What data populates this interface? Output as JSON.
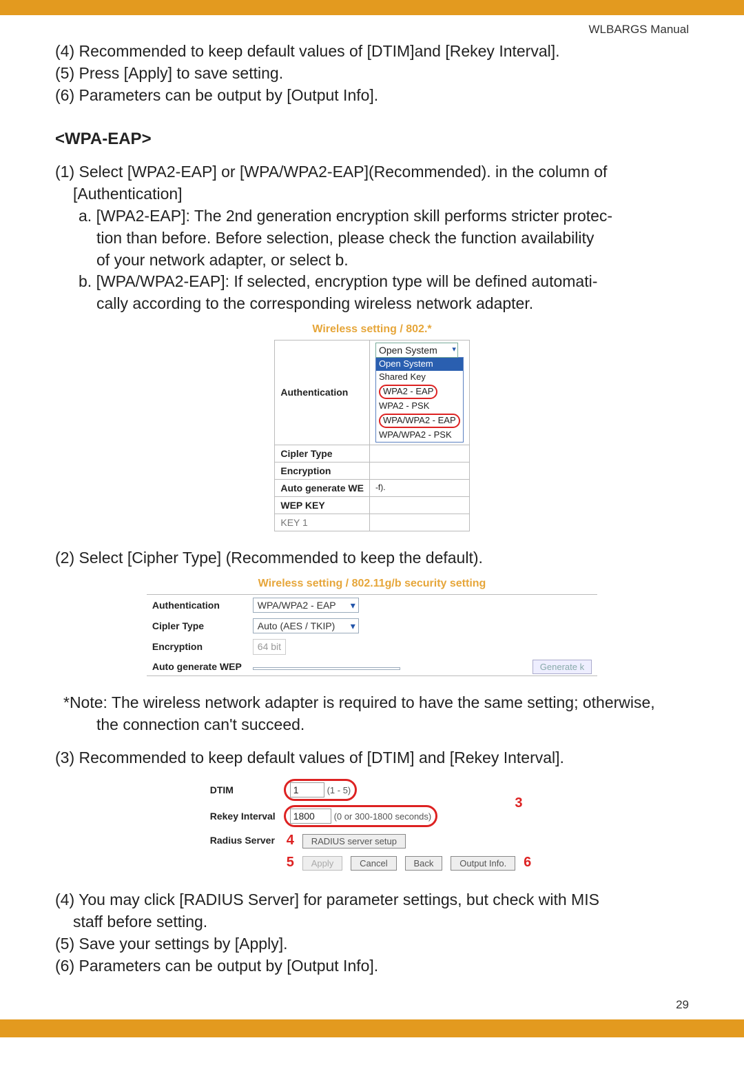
{
  "header": {
    "manual": "WLBARGS Manual",
    "page_number": "29"
  },
  "intro": {
    "l4": "(4) Recommended to keep default values of [DTIM]and [Rekey Interval].",
    "l5": "(5) Press [Apply] to save setting.",
    "l6": "(6) Parameters can be output by [Output Info]."
  },
  "section": {
    "heading": "<WPA-EAP>"
  },
  "step1": {
    "lead": "(1) Select [WPA2-EAP] or [WPA/WPA2-EAP](Recommended). in the column of",
    "lead2": "[Authentication]",
    "a1": "a.  [WPA2-EAP]: The 2nd generation encryption skill performs stricter protec-",
    "a2": "tion than before.  Before selection, please check the function availability",
    "a3": "of your network adapter, or select b.",
    "b1": "b.  [WPA/WPA2-EAP]: If selected, encryption type will be defined automati-",
    "b2": "cally according to the corresponding wireless network adapter."
  },
  "fig1": {
    "title": "Wireless setting / 802.*",
    "rows": {
      "auth": "Authentication",
      "cipher": "Cipler Type",
      "enc": "Encryption",
      "autogen": "Auto generate WE",
      "wepkey": "WEP KEY",
      "key1": "KEY 1"
    },
    "selected": "Open System",
    "options": {
      "o1": "Open System",
      "o2": "Shared Key",
      "o3": "WPA2 - EAP",
      "o4": "WPA2 - PSK",
      "o5": "WPA/WPA2 - EAP",
      "o6": "WPA/WPA2 - PSK"
    },
    "suffix": "-f)."
  },
  "step2": {
    "text": "(2) Select [Cipher Type] (Recommended to keep the default)."
  },
  "fig2": {
    "title": "Wireless setting / 802.11g/b security setting",
    "auth_lbl": "Authentication",
    "auth_val": "WPA/WPA2 - EAP",
    "cipher_lbl": "Cipler Type",
    "cipher_val": "Auto (AES / TKIP)",
    "enc_lbl": "Encryption",
    "enc_val": "64 bit",
    "autogen_lbl": "Auto generate WEP",
    "gen_btn": "Generate k"
  },
  "note": {
    "n1": "*Note: The wireless network adapter is required to have the same setting; otherwise,",
    "n2": "the connection can't succeed."
  },
  "step3": {
    "text": "(3) Recommended to keep default values of [DTIM] and [Rekey Interval]."
  },
  "fig3": {
    "dtim_lbl": "DTIM",
    "dtim_val": "1",
    "dtim_range": "(1 - 5)",
    "rekey_lbl": "Rekey Interval",
    "rekey_val": "1800",
    "rekey_range": "(0 or 300-1800 seconds)",
    "radius_lbl": "Radius Server",
    "radius_btn": "RADIUS server setup",
    "c3": "3",
    "c4": "4",
    "c5": "5",
    "c6": "6",
    "apply": "Apply",
    "cancel": "Cancel",
    "back": "Back",
    "output": "Output Info."
  },
  "tail": {
    "l4a": "(4) You may click [RADIUS Server] for parameter settings, but check with MIS",
    "l4b": "staff before setting.",
    "l5": "(5) Save your settings by [Apply].",
    "l6": "(6) Parameters can be output by [Output Info]."
  }
}
